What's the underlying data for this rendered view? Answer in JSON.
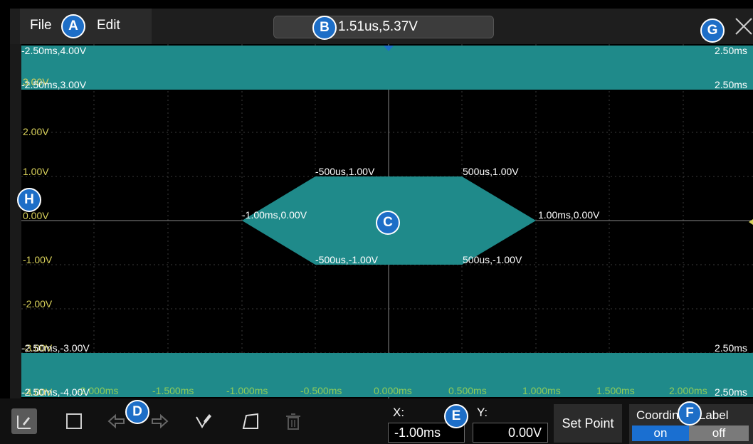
{
  "menu": {
    "file": "File",
    "edit": "Edit"
  },
  "cursor_readout": "1.51us,5.37V",
  "y_axis_labels": [
    "3.00V",
    "2.00V",
    "1.00V",
    "0.00V",
    "-1.00V",
    "-2.00V",
    "-3.00V",
    "-4.00V"
  ],
  "x_axis_labels": [
    "-2.000ms",
    "-1.500ms",
    "-1.000ms",
    "-0.500ms",
    "0.000ms",
    "0.500ms",
    "1.000ms",
    "1.500ms",
    "2.000ms"
  ],
  "mask_region_labels": {
    "top_left_1": "-2.50ms,4.00V",
    "top_right_1": "2.50ms",
    "top_left_2": "-2.50ms,3.00V",
    "top_right_2": "2.50ms",
    "bottom_left_1": "-2.50ms,-3.00V",
    "bottom_right_1": "2.50ms",
    "bottom_left_2": "-2.50ms,-4.00V",
    "bottom_right_2": "2.50ms"
  },
  "polygon_vertex_labels": {
    "top_left": "-500us,1.00V",
    "top_right": "500us,1.00V",
    "left": "-1.00ms,0.00V",
    "right": "1.00ms,0.00V",
    "bottom_left": "-500us,-1.00V",
    "bottom_right": "500us,-1.00V"
  },
  "toolbar": {
    "x_label": "X:",
    "y_label": "Y:",
    "x_value": "-1.00ms",
    "y_value": "0.00V",
    "set_point": "Set Point",
    "coordinate_label_title": "Coordinate Label",
    "toggle_on": "on",
    "toggle_off": "off"
  },
  "callouts": [
    "A",
    "B",
    "C",
    "D",
    "E",
    "F",
    "G",
    "H"
  ],
  "colors": {
    "mask_fill": "#1f8a8a",
    "accent_blue": "#1d6ec7",
    "axis_label_yellow": "#d9d15a",
    "axis_label_green": "#8fcc5a"
  }
}
